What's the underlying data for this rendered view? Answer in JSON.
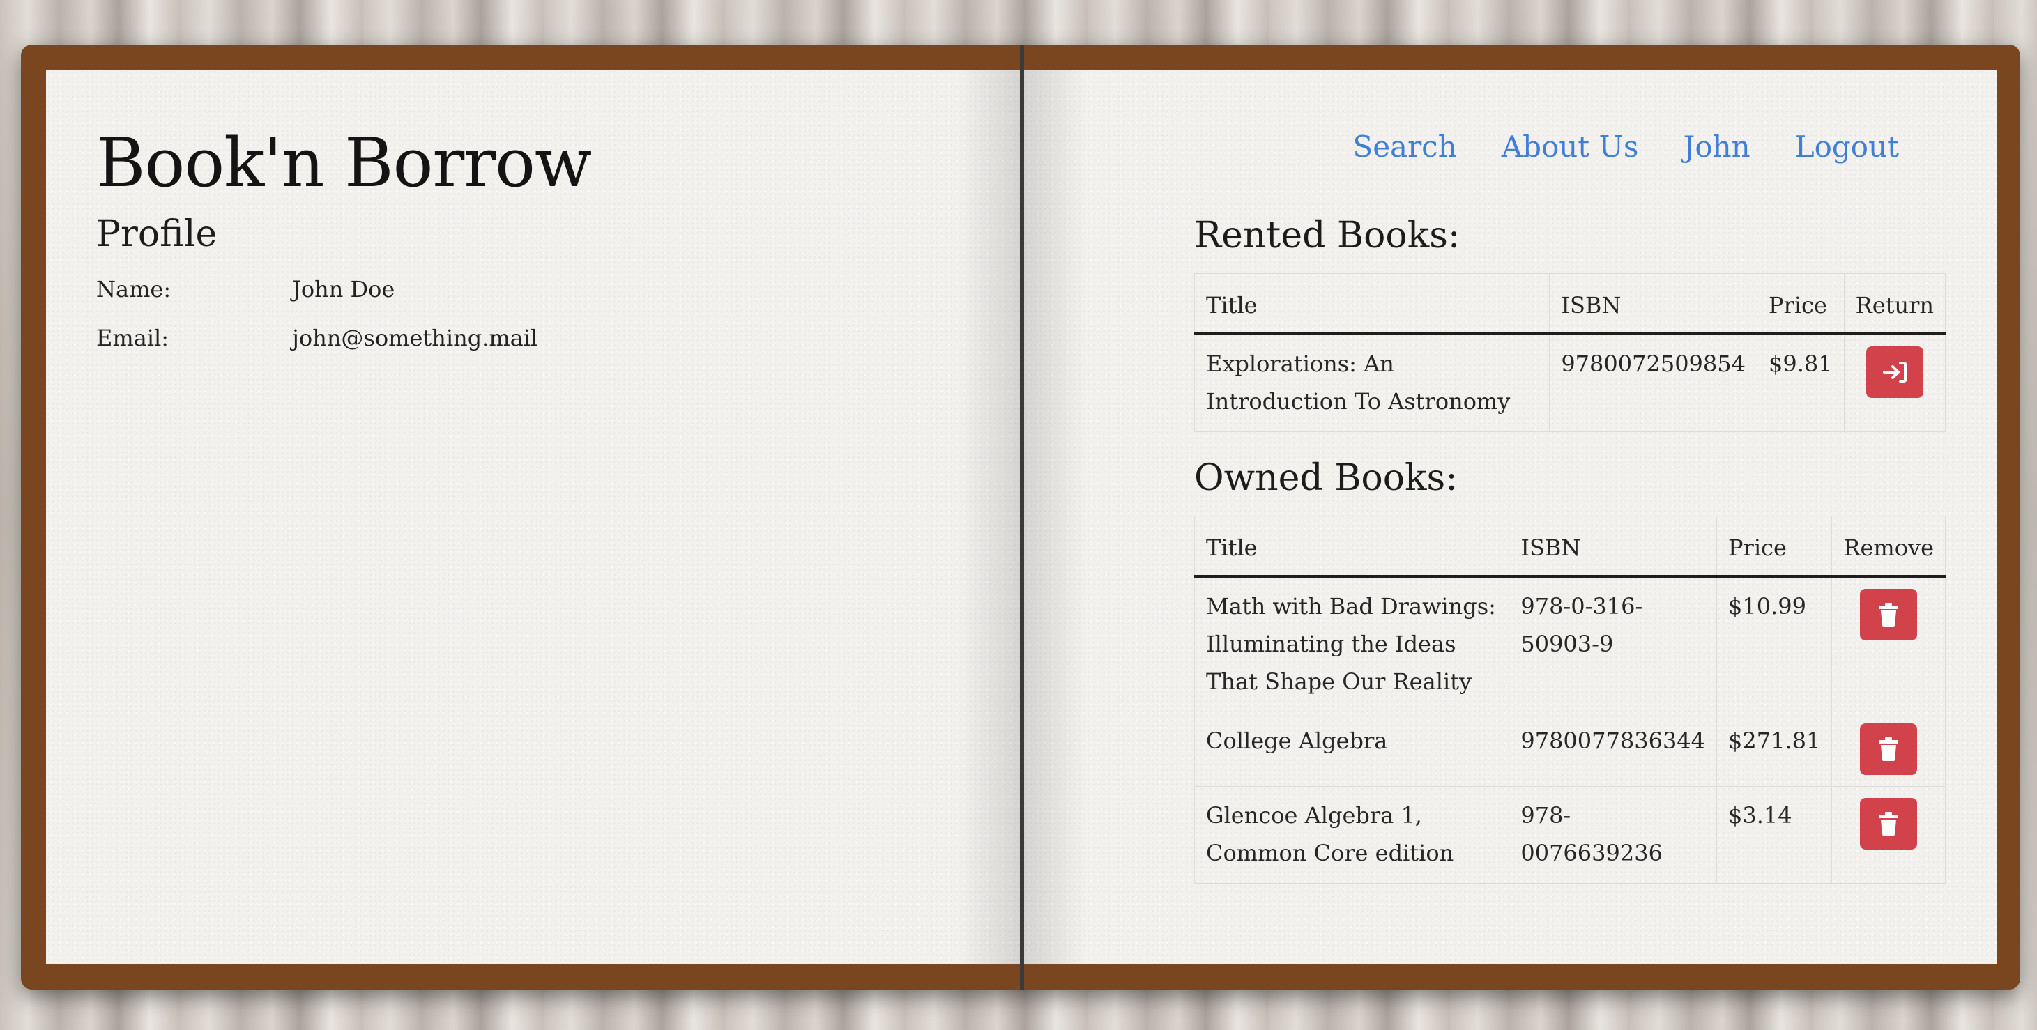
{
  "site": {
    "title": "Book'n Borrow"
  },
  "nav": {
    "items": [
      "Search",
      "About Us",
      "John",
      "Logout"
    ]
  },
  "profile": {
    "heading": "Profile",
    "name_label": "Name:",
    "name_value": "John Doe",
    "email_label": "Email:",
    "email_value": "john@something.mail"
  },
  "rented": {
    "heading": "Rented Books:",
    "columns": [
      "Title",
      "ISBN",
      "Price",
      "Return"
    ],
    "rows": [
      {
        "title": "Explorations: An Introduction To Astronomy",
        "isbn": "9780072509854",
        "price": "$9.81",
        "action_icon": "return-icon"
      }
    ]
  },
  "owned": {
    "heading": "Owned Books:",
    "columns": [
      "Title",
      "ISBN",
      "Price",
      "Remove"
    ],
    "rows": [
      {
        "title": "Math with Bad Drawings: Illuminating the Ideas That Shape Our Reality",
        "isbn": "978-0-316-50903-9",
        "price": "$10.99",
        "action_icon": "trash-icon"
      },
      {
        "title": "College Algebra",
        "isbn": "9780077836344",
        "price": "$271.81",
        "action_icon": "trash-icon"
      },
      {
        "title": "Glencoe Algebra 1, Common Core edition",
        "isbn": "978-0076639236",
        "price": "$3.14",
        "action_icon": "trash-icon"
      }
    ]
  },
  "colors": {
    "cover": "#7a461f",
    "page": "#f3f1ee",
    "link": "#3f7fd6",
    "danger": "#d1424b"
  }
}
